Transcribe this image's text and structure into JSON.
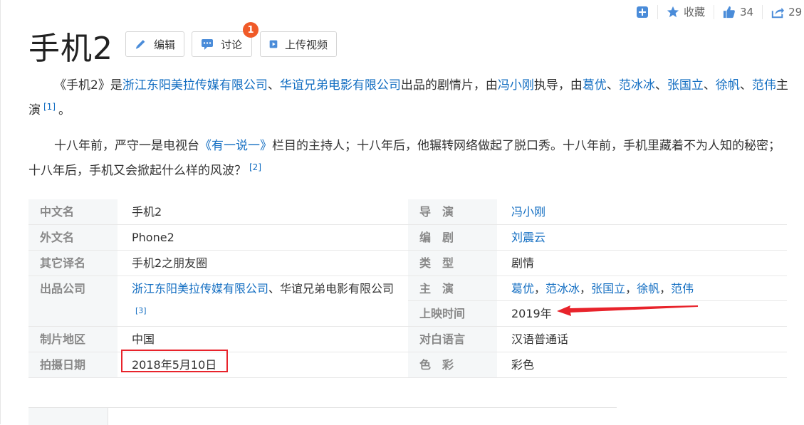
{
  "toolbar": {
    "favorite_label": "收藏",
    "like_count": "34",
    "share_count": "29"
  },
  "title": "手机2",
  "buttons": {
    "edit": "编辑",
    "discuss": "讨论",
    "discuss_badge": "1",
    "upload_video": "上传视频"
  },
  "summary": {
    "open_quote": "《手机2》是",
    "company1": "浙江东阳美拉传媒有限公司",
    "sep1": "、",
    "company2": "华谊兄弟电影有限公司",
    "mid1": "出品的剧情片，由",
    "director": "冯小刚",
    "mid2": "执导，由",
    "actor1": "葛优",
    "sep2": "、",
    "actor2": "范冰冰",
    "sep3": "、",
    "actor3": "张国立",
    "sep4": "、",
    "actor4": "徐帆",
    "sep5": "、",
    "actor5": "范伟",
    "end": "主演",
    "ref": "[1]",
    "period": "。"
  },
  "plot": {
    "part1": "十八年前，严守一是电视台",
    "show": "《有一说一》",
    "part2": "栏目的主持人；十八年后，他辗转网络做起了脱口秀。十八年前，手机里藏着不为人知的秘密；十八年后，手机又会掀起什么样的风波？",
    "ref": "[2]"
  },
  "info": {
    "left": [
      {
        "key": "中文名",
        "value": "手机2"
      },
      {
        "key": "外文名",
        "value": "Phone2"
      },
      {
        "key": "其它译名",
        "value": "手机2之朋友圈"
      },
      {
        "key": "出品公司",
        "value_link": "浙江东阳美拉传媒有限公司",
        "value_rest": "、华谊兄弟电影有限公司",
        "ref": "[3]"
      },
      {
        "key": "制片地区",
        "value": "中国"
      },
      {
        "key": "拍摄日期",
        "value": "2018年5月10日"
      }
    ],
    "right": [
      {
        "key": "导　演",
        "value": "冯小刚"
      },
      {
        "key": "编　剧",
        "value": "刘震云"
      },
      {
        "key": "类　型",
        "value": "剧情"
      },
      {
        "key": "主　演",
        "actors": [
          "葛优",
          "范冰冰",
          "张国立",
          "徐帆",
          "范伟"
        ],
        "separator": "，"
      },
      {
        "key": "上映时间",
        "value": "2019年"
      },
      {
        "key": "对白语言",
        "value": "汉语普通话"
      },
      {
        "key": "色　彩",
        "value": "彩色"
      }
    ]
  },
  "colors": {
    "link": "#136ec2",
    "badge": "#f05a28",
    "annotation_red": "#e8232b",
    "label_bg": "#f5f7f8"
  },
  "icons": [
    "plus-square-icon",
    "star-icon",
    "thumbs-up-icon",
    "share-icon",
    "pencil-icon",
    "chat-icon",
    "play-icon"
  ]
}
